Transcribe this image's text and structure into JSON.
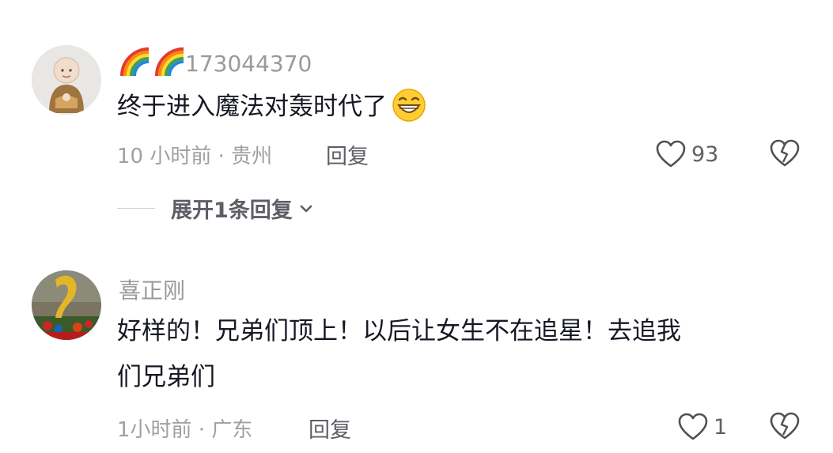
{
  "comments": [
    {
      "username_prefix_icons": [
        "rainbow-icon",
        "rainbow-icon"
      ],
      "username": "173044370",
      "text": "终于进入魔法对轰时代了",
      "emoji": "grinning-face-icon",
      "meta": "10 小时前 · 贵州",
      "reply_label": "回复",
      "likes": "93",
      "expand_label": "展开1条回复"
    },
    {
      "username": "喜正刚",
      "text_line1": "好样的！兄弟们顶上！以后让女生不在追星！去追我",
      "text_line2": "们兄弟们",
      "meta": "1小时前 · 广东",
      "reply_label": "回复",
      "likes": "1"
    }
  ],
  "colors": {
    "text": "#161823",
    "secondary": "#9a9a9a",
    "action": "#5e5e66"
  }
}
